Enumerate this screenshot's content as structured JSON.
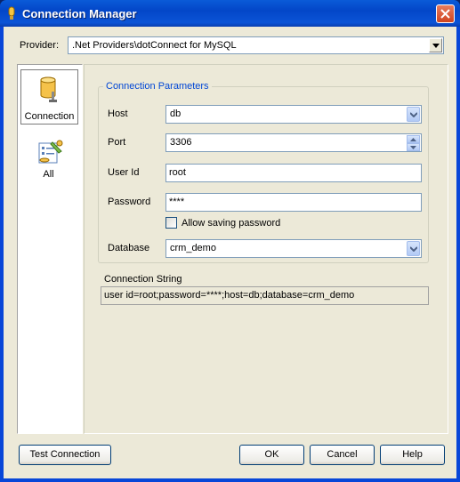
{
  "window": {
    "title": "Connection Manager"
  },
  "provider": {
    "label": "Provider:",
    "value": ".Net Providers\\dotConnect for MySQL"
  },
  "nav": {
    "items": [
      {
        "label": "Connection",
        "icon": "database-cylinder-icon",
        "selected": true
      },
      {
        "label": "All",
        "icon": "properties-list-icon",
        "selected": false
      }
    ]
  },
  "params": {
    "group_title": "Connection Parameters",
    "host_label": "Host",
    "host_value": "db",
    "port_label": "Port",
    "port_value": "3306",
    "userid_label": "User Id",
    "userid_value": "root",
    "password_label": "Password",
    "password_value": "****",
    "allow_saving_label": "Allow saving password",
    "allow_saving_checked": false,
    "database_label": "Database",
    "database_value": "crm_demo"
  },
  "connection_string": {
    "label": "Connection String",
    "value": "user id=root;password=****;host=db;database=crm_demo"
  },
  "buttons": {
    "test": "Test Connection",
    "ok": "OK",
    "cancel": "Cancel",
    "help": "Help"
  },
  "colors": {
    "title_bar": "#0346c8",
    "dialog_bg": "#ece9d8",
    "group_title": "#0046d5",
    "close_button": "#d0441f"
  }
}
